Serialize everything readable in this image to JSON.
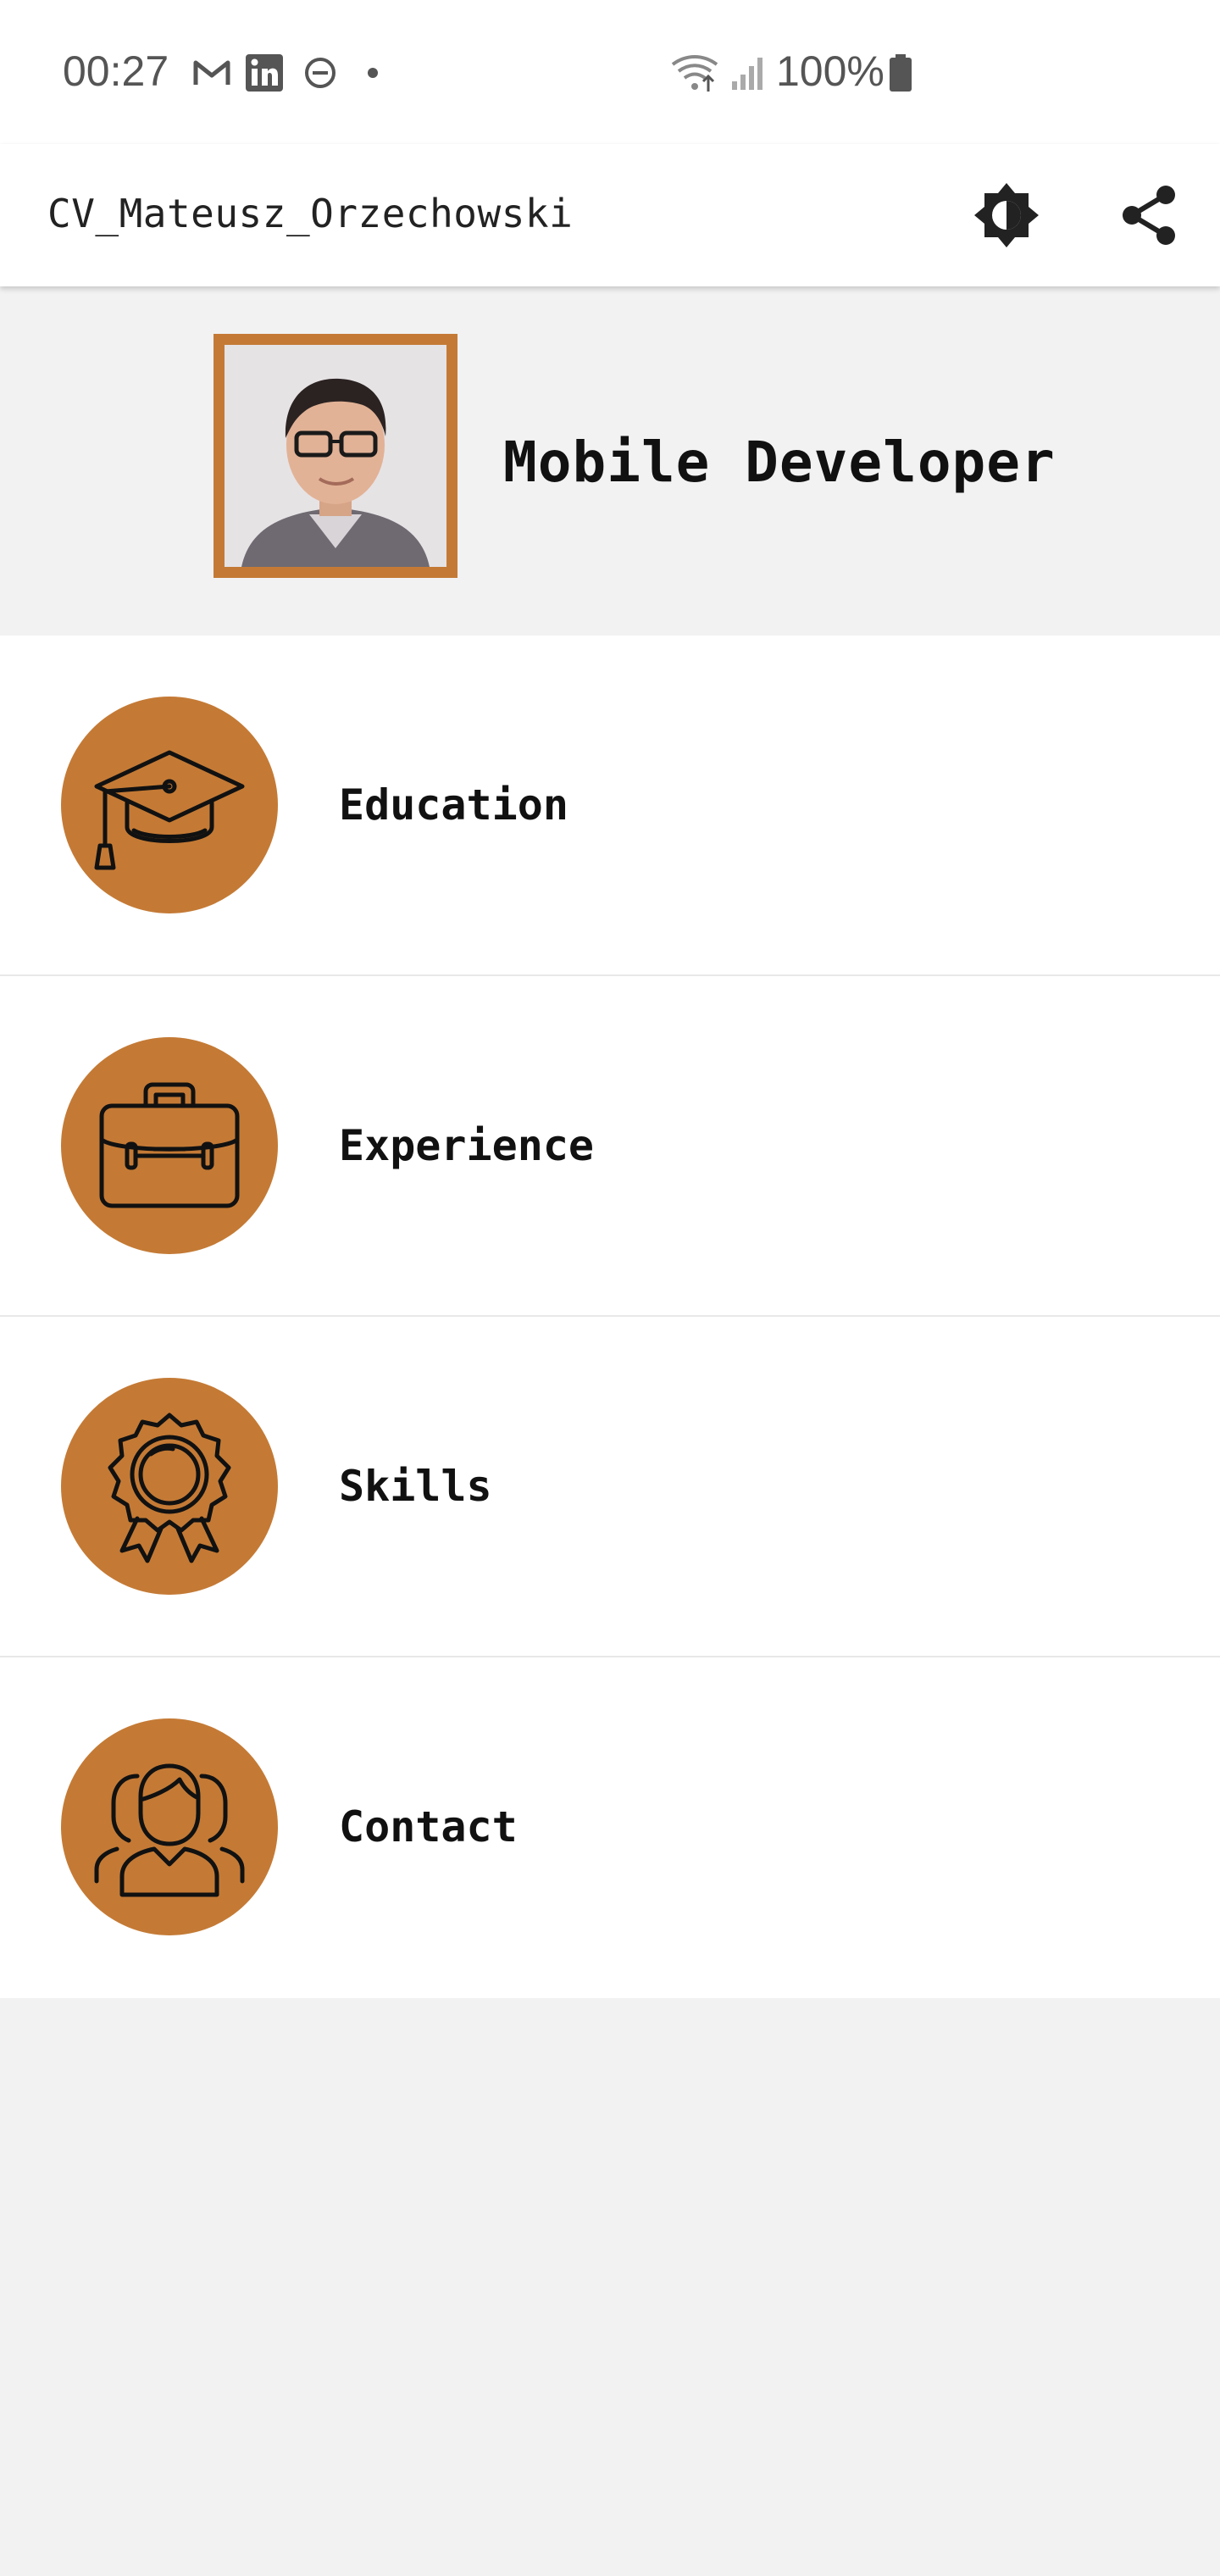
{
  "status_bar": {
    "time": "00:27",
    "battery": "100%",
    "icons": [
      "gmail-icon",
      "linkedin-icon",
      "do-not-disturb-icon",
      "dot-icon",
      "wifi-icon",
      "signal-icon",
      "battery-icon"
    ]
  },
  "app_bar": {
    "title": "CV_Mateusz_Orzechowski",
    "actions": [
      "theme-toggle-icon",
      "share-icon"
    ]
  },
  "header": {
    "role": "Mobile Developer"
  },
  "menu": {
    "items": [
      {
        "label": "Education",
        "icon": "graduation-cap-icon"
      },
      {
        "label": "Experience",
        "icon": "briefcase-icon"
      },
      {
        "label": "Skills",
        "icon": "award-badge-icon"
      },
      {
        "label": "Contact",
        "icon": "contacts-group-icon"
      }
    ]
  },
  "colors": {
    "accent": "#c47a35",
    "background": "#f2f2f2",
    "surface": "#ffffff"
  }
}
